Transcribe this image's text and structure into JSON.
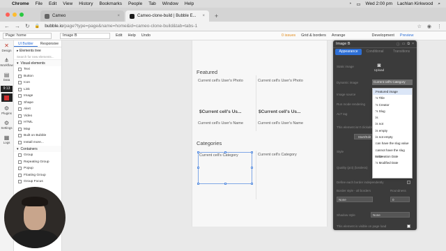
{
  "macmenu": {
    "items": [
      "Chrome",
      "File",
      "Edit",
      "View",
      "History",
      "Bookmarks",
      "People",
      "Tab",
      "Window",
      "Help"
    ],
    "clock": "Wed 2:00 pm",
    "user": "Lachlan Kirkwood"
  },
  "browser": {
    "tabs": [
      {
        "label": "Cameo",
        "active": false
      },
      {
        "label": "Cameo-clone-build | Bubble E...",
        "active": true
      }
    ],
    "url_host": "bubble.io",
    "url_path": "/page?type=page&name=home&id=cameo-clone-build&tab=tabs-1"
  },
  "toolbar": {
    "page_select": "Page: home",
    "element_select": "Image B",
    "edit": "Edit",
    "help": "Help",
    "undo": "Undo",
    "issues": "0 issues",
    "grid": "Grid & borders",
    "arrange": "Arrange",
    "branch": "Development",
    "preview": "Preview"
  },
  "leftnav": {
    "items": [
      "Design",
      "Workflow",
      "Data",
      "Styles",
      "Plugins",
      "Settings",
      "Logs"
    ],
    "time": "9:13"
  },
  "palette": {
    "tabs": [
      "UI Builder",
      "Responsive"
    ],
    "elements_tree": "Elements tree",
    "search_placeholder": "Search for new elements...",
    "visual_header": "Visual elements",
    "visual": [
      "Text",
      "Button",
      "Icon",
      "Link",
      "Image",
      "Shape",
      "Alert",
      "Video",
      "HTML",
      "Map",
      "Built on Bubble",
      "Install more..."
    ],
    "containers_header": "Containers",
    "containers": [
      "Group",
      "Repeating Group",
      "Popup",
      "Floating Group",
      "Group Focus"
    ]
  },
  "canvas": {
    "featured": "Featured",
    "photo1": "Current cell's User's Photo",
    "photo2": "Current cell's User's Photo",
    "name_bold1": "$Current cell's Us...",
    "name_bold2": "$Current cell's Us...",
    "name1": "Current cell's User's Name",
    "name2": "Current cell's User's Name",
    "categories": "Categories",
    "cat1": "Current cell's Category",
    "cat2": "Current cell's Category"
  },
  "inspector": {
    "title": "Image B",
    "tabs": [
      "Appearance",
      "Conditional",
      "Transitions"
    ],
    "static_image": "Static image",
    "upload": "Upload",
    "dynamic_image": "Dynamic image",
    "dynamic_value": "Current cell's Category",
    "labels": [
      "Image source",
      "Run mode rendering",
      "ALT tag",
      "This element isn't clickable",
      "Style",
      "Quality (pct) (lossless)",
      "Define each border independently",
      "Border style - all borders",
      "Shadow style",
      "This element is visible on page load"
    ],
    "button_text": "Start/Edit",
    "border_value": "None",
    "roundness_label": "Roundness",
    "roundness_value": "0",
    "shadow_value": "None"
  },
  "dropdown": {
    "items": [
      ":Featured image",
      ":'s Title",
      ":'s Creator",
      ":'s Slug",
      ":is",
      ":is not",
      ":is empty",
      ":is not empty",
      ":can have the slug value",
      ":cannot have the slug value",
      ":'s Creation Date",
      ":'s Modified Date"
    ],
    "highlighted": 0
  }
}
